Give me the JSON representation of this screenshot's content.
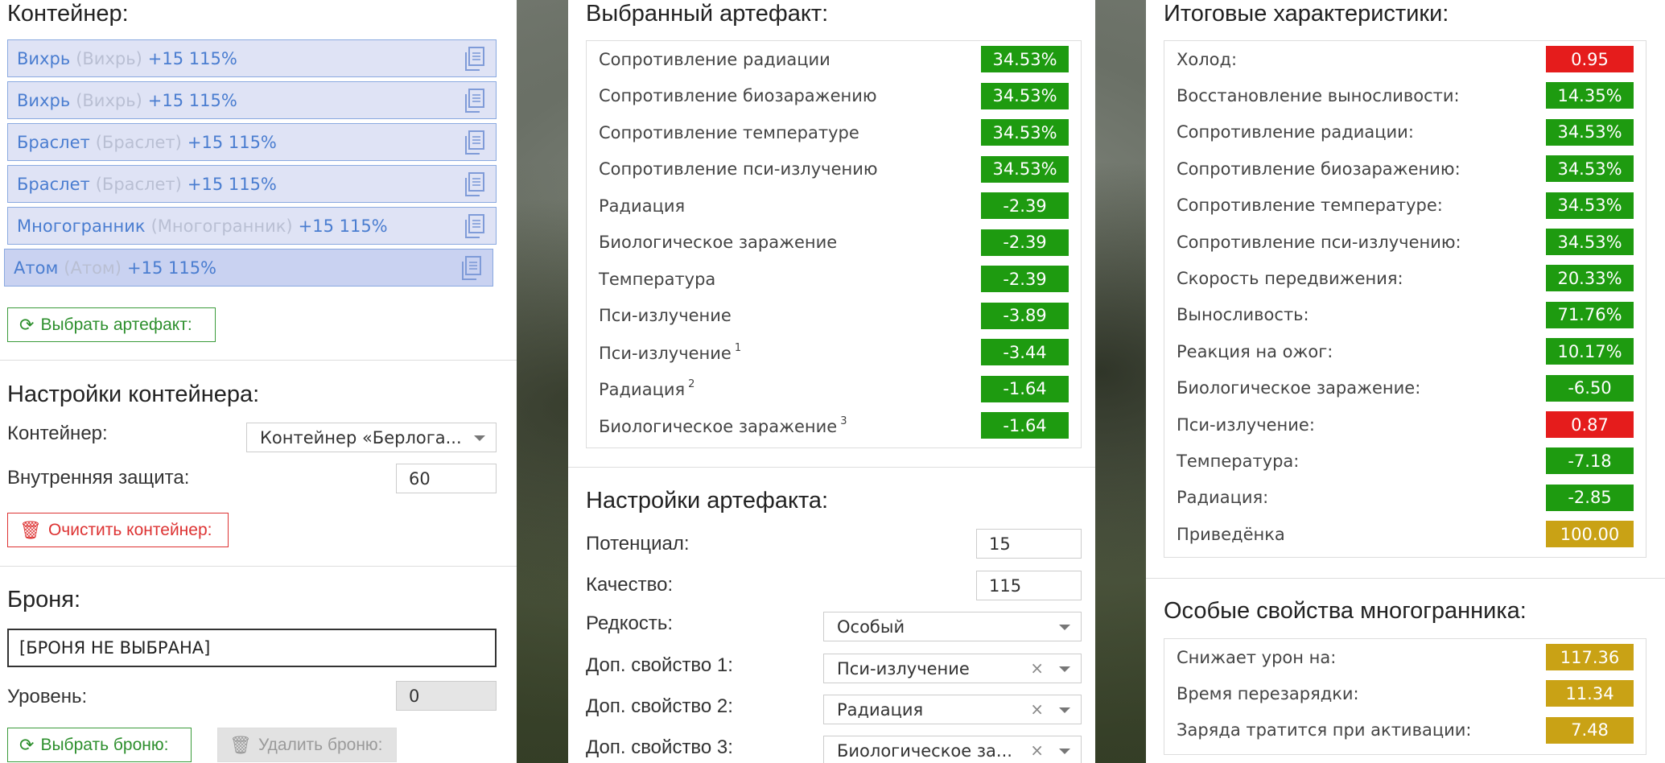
{
  "colors": {
    "good": "#1e9b10",
    "bad": "#e51c1c",
    "neutral": "#c9a215"
  },
  "left": {
    "container_title": "Контейнер:",
    "slots": [
      {
        "name": "Вихрь",
        "alt": "(Вихрь)",
        "suffix": "+15 115%"
      },
      {
        "name": "Вихрь",
        "alt": "(Вихрь)",
        "suffix": "+15 115%"
      },
      {
        "name": "Браслет",
        "alt": "(Браслет)",
        "suffix": "+15 115%"
      },
      {
        "name": "Браслет",
        "alt": "(Браслет)",
        "suffix": "+15 115%"
      },
      {
        "name": "Многогранник",
        "alt": "(Многогранник)",
        "suffix": "+15 115%"
      },
      {
        "name": "Атом",
        "alt": "(Атом)",
        "suffix": "+15 115%"
      }
    ],
    "select_artifact_button": "Выбрать артефакт:",
    "settings_title": "Настройки контейнера:",
    "container_label": "Контейнер:",
    "container_value": "Контейнер «Берлога...",
    "internal_protection_label": "Внутренняя защита:",
    "internal_protection_value": "60",
    "clear_button": "Очистить контейнер:",
    "armor_title": "Броня:",
    "armor_value": "[БРОНЯ НЕ ВЫБРАНА]",
    "level_label": "Уровень:",
    "level_value": "0",
    "select_armor_button": "Выбрать броню:",
    "delete_armor_button": "Удалить броню:"
  },
  "middle": {
    "selected_title": "Выбранный артефакт:",
    "stats": [
      {
        "name": "Сопротивление радиации",
        "sup": "",
        "value": "34.53%",
        "status": "good"
      },
      {
        "name": "Сопротивление биозаражению",
        "sup": "",
        "value": "34.53%",
        "status": "good"
      },
      {
        "name": "Сопротивление температуре",
        "sup": "",
        "value": "34.53%",
        "status": "good"
      },
      {
        "name": "Сопротивление пси-излучению",
        "sup": "",
        "value": "34.53%",
        "status": "good"
      },
      {
        "name": "Радиация",
        "sup": "",
        "value": "-2.39",
        "status": "good"
      },
      {
        "name": "Биологическое заражение",
        "sup": "",
        "value": "-2.39",
        "status": "good"
      },
      {
        "name": "Температура",
        "sup": "",
        "value": "-2.39",
        "status": "good"
      },
      {
        "name": "Пси-излучение",
        "sup": "",
        "value": "-3.89",
        "status": "good"
      },
      {
        "name": "Пси-излучение",
        "sup": "1",
        "value": "-3.44",
        "status": "good"
      },
      {
        "name": "Радиация",
        "sup": "2",
        "value": "-1.64",
        "status": "good"
      },
      {
        "name": "Биологическое заражение",
        "sup": "3",
        "value": "-1.64",
        "status": "good"
      }
    ],
    "settings_title": "Настройки артефакта:",
    "potential_label": "Потенциал:",
    "potential_value": "15",
    "quality_label": "Качество:",
    "quality_value": "115",
    "rarity_label": "Редкость:",
    "rarity_value": "Особый",
    "extra1_label": "Доп. свойство 1:",
    "extra1_value": "Пси-излучение",
    "extra2_label": "Доп. свойство 2:",
    "extra2_value": "Радиация",
    "extra3_label": "Доп. свойство 3:",
    "extra3_value": "Биологическое за...",
    "clear_symbol": "×"
  },
  "right": {
    "totals_title": "Итоговые характеристики:",
    "totals": [
      {
        "name": "Холод:",
        "value": "0.95",
        "status": "bad"
      },
      {
        "name": "Восстановление выносливости:",
        "value": "14.35%",
        "status": "good"
      },
      {
        "name": "Сопротивление радиации:",
        "value": "34.53%",
        "status": "good"
      },
      {
        "name": "Сопротивление биозаражению:",
        "value": "34.53%",
        "status": "good"
      },
      {
        "name": "Сопротивление температуре:",
        "value": "34.53%",
        "status": "good"
      },
      {
        "name": "Сопротивление пси-излучению:",
        "value": "34.53%",
        "status": "good"
      },
      {
        "name": "Скорость передвижения:",
        "value": "20.33%",
        "status": "good"
      },
      {
        "name": "Выносливость:",
        "value": "71.76%",
        "status": "good"
      },
      {
        "name": "Реакция на ожог:",
        "value": "10.17%",
        "status": "good"
      },
      {
        "name": "Биологическое заражение:",
        "value": "-6.50",
        "status": "good"
      },
      {
        "name": "Пси-излучение:",
        "value": "0.87",
        "status": "bad"
      },
      {
        "name": "Температура:",
        "value": "-7.18",
        "status": "good"
      },
      {
        "name": "Радиация:",
        "value": "-2.85",
        "status": "good"
      },
      {
        "name": "Приведёнка",
        "value": "100.00",
        "status": "neutral"
      }
    ],
    "special_title": "Особые свойства многогранника:",
    "special": [
      {
        "name": "Снижает урон на:",
        "value": "117.36",
        "status": "neutral"
      },
      {
        "name": "Время перезарядки:",
        "value": "11.34",
        "status": "neutral"
      },
      {
        "name": "Заряда тратится при активации:",
        "value": "7.48",
        "status": "neutral"
      }
    ]
  }
}
